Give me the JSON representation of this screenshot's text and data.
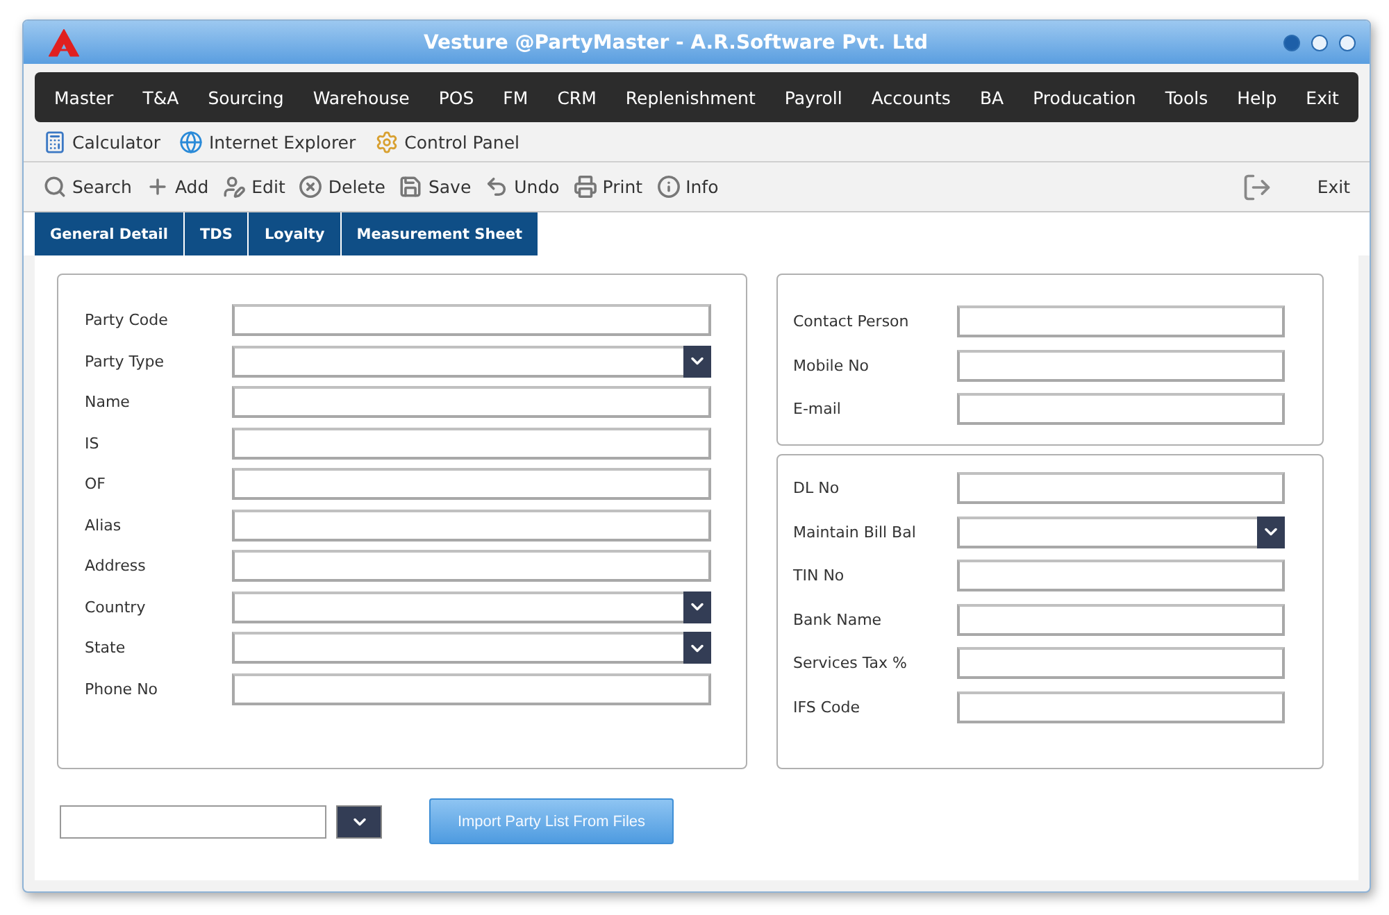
{
  "window": {
    "title": "Vesture @PartyMaster - A.R.Software Pvt. Ltd"
  },
  "menu": [
    "Master",
    "T&A",
    "Sourcing",
    "Warehouse",
    "POS",
    "FM",
    "CRM",
    "Replenishment",
    "Payroll",
    "Accounts",
    "BA",
    "Producation",
    "Tools",
    "Help",
    "Exit"
  ],
  "quick_launch": [
    {
      "kind": "calculator",
      "label": "Calculator"
    },
    {
      "kind": "browser",
      "label": "Internet Explorer"
    },
    {
      "kind": "control",
      "label": "Control Panel"
    }
  ],
  "toolbar": [
    {
      "kind": "search",
      "label": "Search"
    },
    {
      "kind": "add",
      "label": "Add"
    },
    {
      "kind": "edit",
      "label": "Edit"
    },
    {
      "kind": "delete",
      "label": "Delete"
    },
    {
      "kind": "save",
      "label": "Save"
    },
    {
      "kind": "undo",
      "label": "Undo"
    },
    {
      "kind": "print",
      "label": "Print"
    },
    {
      "kind": "info",
      "label": "Info"
    }
  ],
  "exit_button": {
    "label": "Exit"
  },
  "tabs": [
    "General Detail",
    "TDS",
    "Loyalty",
    "Measurement Sheet"
  ],
  "left_panel": {
    "fields": [
      {
        "label": "Party Code",
        "kind": "text"
      },
      {
        "label": "Party Type",
        "kind": "select"
      },
      {
        "label": "Name",
        "kind": "text"
      },
      {
        "label": "IS",
        "kind": "text"
      },
      {
        "label": "OF",
        "kind": "text"
      },
      {
        "label": "Alias",
        "kind": "text"
      },
      {
        "label": "Address",
        "kind": "text"
      },
      {
        "label": "Country",
        "kind": "select"
      },
      {
        "label": "State",
        "kind": "select"
      },
      {
        "label": "Phone No",
        "kind": "text"
      }
    ]
  },
  "contact_panel": {
    "fields": [
      {
        "label": "Contact Person",
        "kind": "text"
      },
      {
        "label": "Mobile No",
        "kind": "text"
      },
      {
        "label": "E-mail",
        "kind": "text"
      }
    ]
  },
  "bank_panel": {
    "fields": [
      {
        "label": "DL No",
        "kind": "text"
      },
      {
        "label": "Maintain Bill Bal",
        "kind": "select"
      },
      {
        "label": "TIN No",
        "kind": "text"
      },
      {
        "label": "Bank Name",
        "kind": "text"
      },
      {
        "label": "Services Tax %",
        "kind": "text"
      },
      {
        "label": "IFS Code",
        "kind": "text"
      }
    ]
  },
  "import_button": {
    "label": "Import Party List From Files"
  }
}
